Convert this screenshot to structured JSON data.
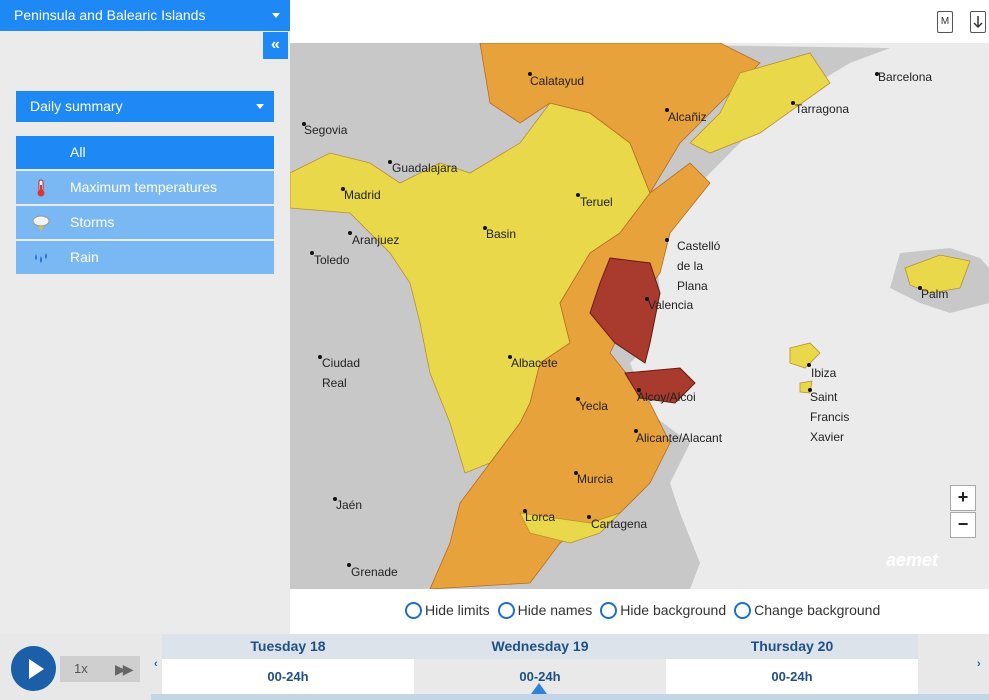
{
  "sidebar": {
    "region": "Peninsula and Balearic Islands",
    "collapse": "«",
    "summary": "Daily summary",
    "filters": [
      {
        "label": "All",
        "icon": ""
      },
      {
        "label": "Maximum temperatures",
        "icon": "thermometer-icon"
      },
      {
        "label": "Storms",
        "icon": "storm-icon"
      },
      {
        "label": "Rain",
        "icon": "rain-icon"
      }
    ]
  },
  "toolbar": {
    "icon1": "M",
    "icon1_name": "document-icon",
    "icon2_name": "download-icon"
  },
  "map": {
    "cities": [
      "Calatayud",
      "Barcelona",
      "Tarragona",
      "Alcañiz",
      "Segovia",
      "Guadalajara",
      "Madrid",
      "Teruel",
      "Basin",
      "Aranjuez",
      "Toledo",
      "Castelló\nde la\nPlana",
      "Valencia",
      "Palm",
      "Ciudad\nReal",
      "Albacete",
      "Ibiza",
      "Alcoy/Alcoi",
      "Yecla",
      "Saint\nFrancis\nXavier",
      "Alicante/Alacant",
      "Murcia",
      "Jaén",
      "Lorca",
      "Cartagena",
      "Grenade"
    ],
    "zoom_in": "+",
    "zoom_out": "−",
    "brand": "aemet",
    "colors": {
      "yellow": "#e8d84a",
      "orange": "#e8a23c",
      "red": "#a83a2e",
      "terrain": "#c8c8c8",
      "sea": "#ebebeb"
    }
  },
  "options": [
    "Hide limits",
    "Hide names",
    "Hide background",
    "Change background"
  ],
  "timeline": {
    "speed": "1x",
    "prev": "‹",
    "next": "›",
    "days": [
      {
        "day": "Tuesday 18",
        "range": "00-24h"
      },
      {
        "day": "Wednesday 19",
        "range": "00-24h"
      },
      {
        "day": "Thursday 20",
        "range": "00-24h"
      }
    ]
  }
}
